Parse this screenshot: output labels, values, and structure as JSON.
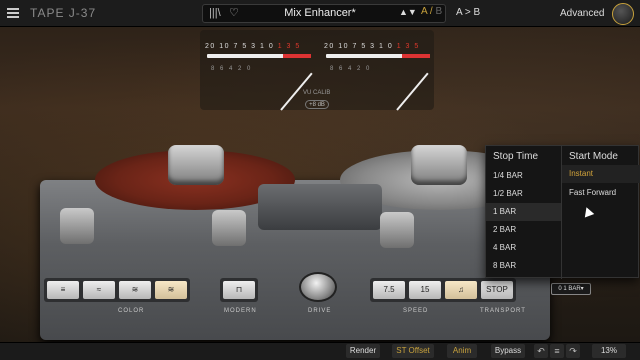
{
  "header": {
    "product": "TAPE J-37",
    "preset_name": "Mix Enhancer*",
    "ab_a": "A",
    "ab_b": "B",
    "ab_copy": "A > B",
    "advanced_label": "Advanced",
    "arrows": "▲▼"
  },
  "vu": {
    "scale": [
      "20",
      "10",
      "7",
      "5",
      "3",
      "1",
      "0",
      "1",
      "3",
      "5"
    ],
    "sub_scale": "8 6 4 2 0",
    "cal_label": "VU CALIB",
    "cal_value": "+8 dB"
  },
  "deck": {
    "color_label": "COLOR",
    "modern_label": "MODERN",
    "drive_label": "DRIVE",
    "speed_label": "SPEED",
    "transport_label": "TRANSPORT",
    "speed_values": [
      "7.5",
      "15"
    ],
    "stop_label": "STOP",
    "bars_display": "0 1 BAR▾"
  },
  "dropdown": {
    "stop_time_header": "Stop Time",
    "start_mode_header": "Start Mode",
    "stop_time_items": [
      "1/4 BAR",
      "1/2 BAR",
      "1 BAR",
      "2 BAR",
      "4 BAR",
      "8 BAR"
    ],
    "selected_stop_time": "1 BAR",
    "start_mode_items": [
      "Instant",
      "Fast Forward"
    ],
    "selected_start_mode": "Instant"
  },
  "footer": {
    "render": "Render",
    "st_offset": "ST Offset",
    "anim": "Anim",
    "bypass": "Bypass",
    "zoom": "13%"
  },
  "colors": {
    "accent": "#c8a23c",
    "vu_red": "#e0382c"
  }
}
